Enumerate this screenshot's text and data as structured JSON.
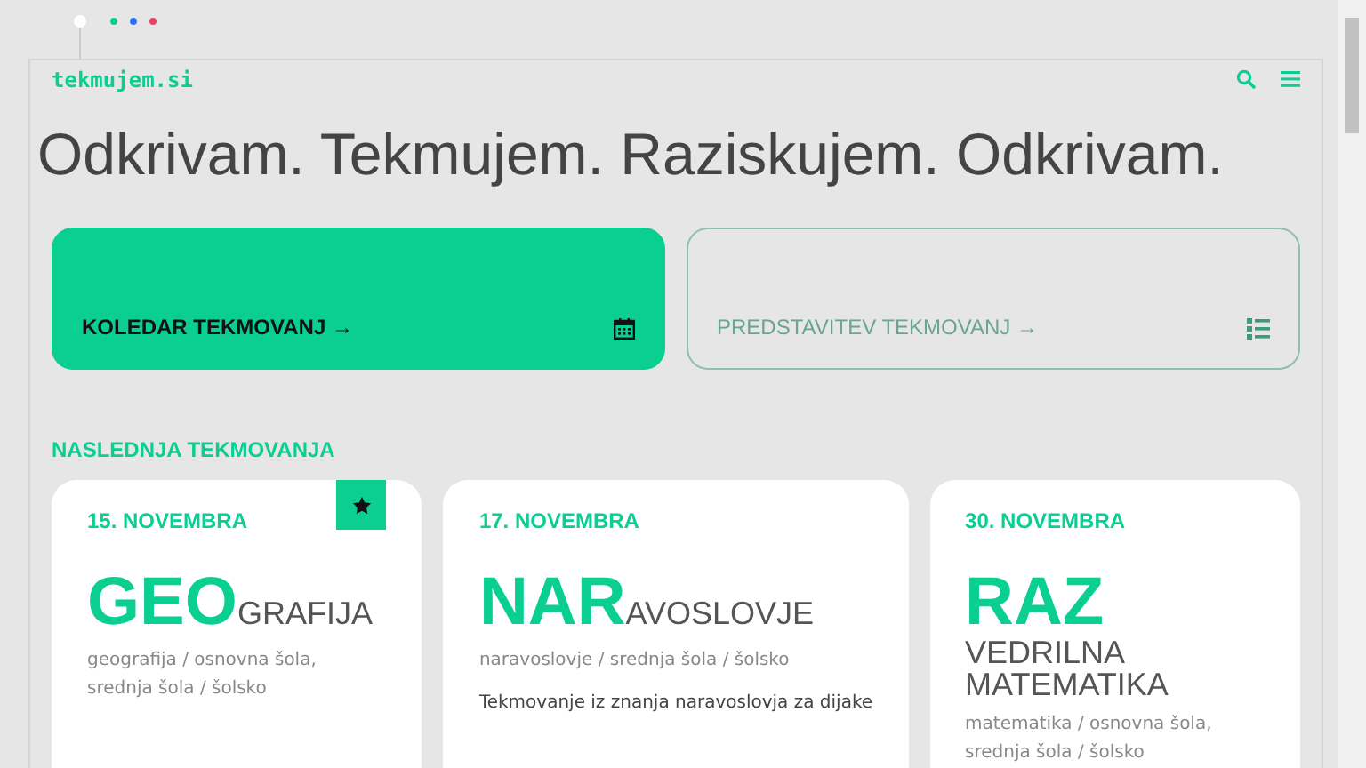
{
  "logo": "tekmujem.si",
  "marquee": "Odkrivam. Tekmujem. Raziskujem. Odkrivam.",
  "actions": [
    {
      "label": "KOLEDAR TEKMOVANJ",
      "arrow": "→",
      "kind": "filled"
    },
    {
      "label": "PREDSTAVITEV TEKMOVANJ",
      "arrow": "→",
      "kind": "outline"
    }
  ],
  "section_title": "NASLEDNJA TEKMOVANJA",
  "events": [
    {
      "date": "15. NOVEMBRA",
      "abbr": "GEO",
      "rest": "GRAFIJA",
      "meta": "geografija / osnovna šola, srednja šola / šolsko",
      "favorite": true
    },
    {
      "date": "17. NOVEMBRA",
      "abbr": "NAR",
      "rest": "AVOSLOVJE",
      "meta": "naravoslovje / srednja šola / šolsko",
      "description": "Tekmovanje iz znanja naravoslovja za dijake",
      "favorite": false
    },
    {
      "date": "30. NOVEMBRA",
      "abbr": "RAZ",
      "rest": "VEDRILNA MATEMATIKA",
      "meta": "matematika / osnovna šola, srednja šola / šolsko",
      "favorite": false
    }
  ]
}
